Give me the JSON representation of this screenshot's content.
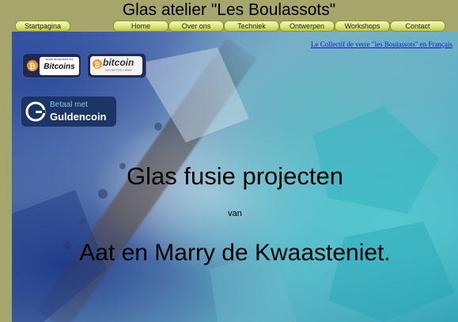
{
  "site_title": "Glas atelier \"Les Boulassots\"",
  "nav": {
    "startpagina": "Startpagina",
    "home": "Home",
    "over_ons": "Over ons",
    "techniek": "Techniek",
    "ontwerpen": "Ontwerpen",
    "workshops": "Workshops",
    "contact": "Contact"
  },
  "french_link": "Le Collectif de verre \"les Boulassots\" en Français",
  "badges": {
    "bitcoin_accept_small": "Nous acceptons les",
    "bitcoin_accept_big": "Bitcoins",
    "bitcoin_logo": "bitcoin",
    "bitcoin_logo_sub": "ACCEPTED HERE",
    "guldencoin_line1": "Betaal met",
    "guldencoin_line2": "Guldencoin"
  },
  "main": {
    "title": "Glas fusie projecten",
    "van": "van",
    "authors": "Aat en Marry de Kwaasteniet."
  },
  "colors": {
    "page_bg": "#a5a56c",
    "nav_button": "#dbe77c",
    "link": "#1a1ad8"
  }
}
